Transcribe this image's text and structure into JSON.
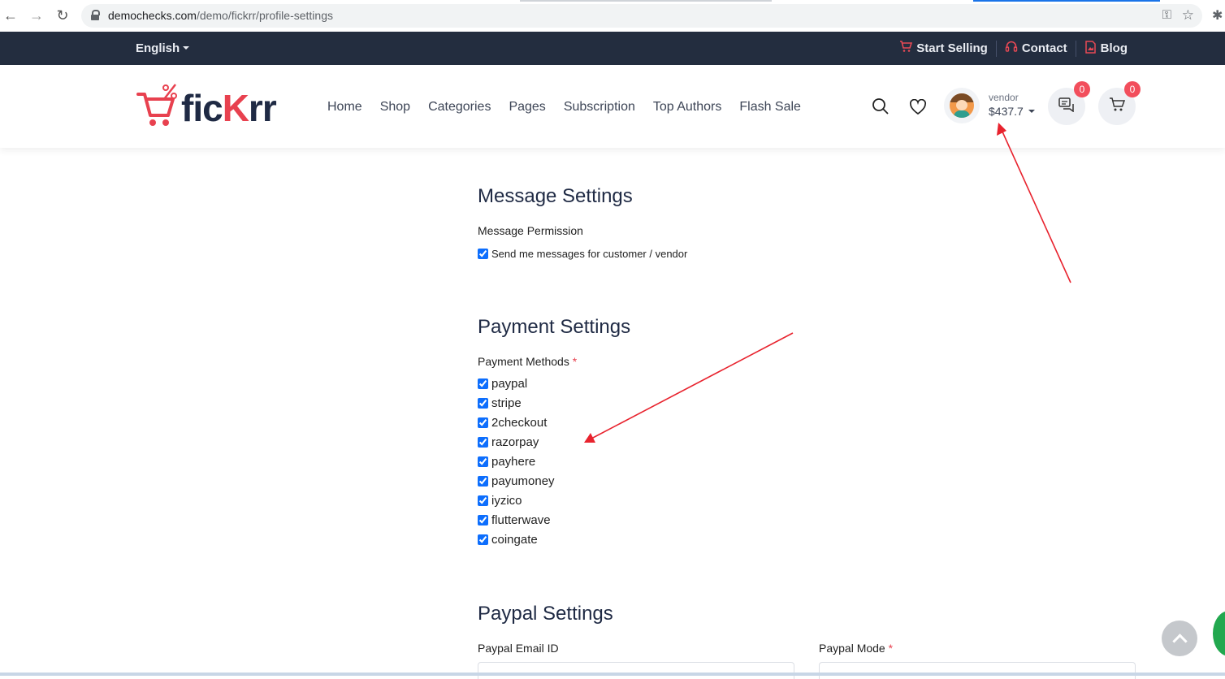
{
  "browser": {
    "url_host": "demochecks.com",
    "url_path": "/demo/fickrr/profile-settings"
  },
  "topbar": {
    "language": "English",
    "links": [
      {
        "label": "Start Selling",
        "icon": "cart-icon"
      },
      {
        "label": "Contact",
        "icon": "headset-icon"
      },
      {
        "label": "Blog",
        "icon": "image-icon"
      }
    ]
  },
  "header": {
    "logo": {
      "prefix": "fic",
      "accent": "K",
      "suffix": "rr"
    },
    "nav": [
      "Home",
      "Shop",
      "Categories",
      "Pages",
      "Subscription",
      "Top Authors",
      "Flash Sale"
    ],
    "user": {
      "role": "vendor",
      "balance": "$437.7"
    },
    "messages_count": "0",
    "cart_count": "0"
  },
  "message_settings": {
    "title": "Message Settings",
    "permission_label": "Message Permission",
    "option": "Send me messages for customer / vendor",
    "checked": true
  },
  "payment_settings": {
    "title": "Payment Settings",
    "methods_label": "Payment Methods",
    "required_mark": "*",
    "methods": [
      "paypal",
      "stripe",
      "2checkout",
      "razorpay",
      "payhere",
      "payumoney",
      "iyzico",
      "flutterwave",
      "coingate"
    ]
  },
  "paypal_settings": {
    "title": "Paypal Settings",
    "email_label": "Paypal Email ID",
    "mode_label": "Paypal Mode",
    "required_mark": "*"
  },
  "colors": {
    "topbar_bg": "#232d3f",
    "accent_red": "#e8414f",
    "badge": "#f24e5c",
    "annotation_arrow": "#e8232e"
  }
}
